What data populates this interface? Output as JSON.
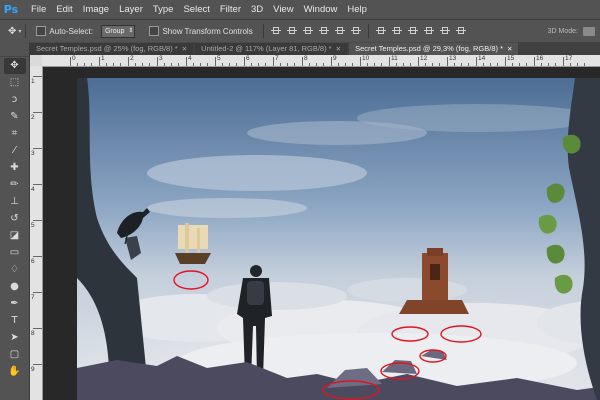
{
  "app": {
    "logo": "Ps"
  },
  "menu": [
    "File",
    "Edit",
    "Image",
    "Layer",
    "Type",
    "Select",
    "Filter",
    "3D",
    "View",
    "Window",
    "Help"
  ],
  "options": {
    "auto_select_label": "Auto-Select:",
    "auto_select_value": "Group",
    "transform_label": "Show Transform Controls",
    "mode_3d_label": "3D Mode:"
  },
  "document_tabs": [
    {
      "label": "Secret Temples.psd @ 25% (fog, RGB/8) *",
      "active": false
    },
    {
      "label": "Untitled-2 @ 117% (Layer 81, RGB/8) *",
      "active": false
    },
    {
      "label": "Secret Temples.psd @ 29,3% (fog, RGB/8) *",
      "active": true
    }
  ],
  "ruler": {
    "h_numbers": [
      "0",
      "1",
      "2",
      "3",
      "4",
      "5",
      "6",
      "7",
      "8",
      "9",
      "10",
      "11",
      "12",
      "13",
      "14",
      "15",
      "16",
      "17"
    ],
    "v_numbers": [
      "1",
      "2",
      "3",
      "4",
      "5",
      "6",
      "7",
      "8",
      "9"
    ]
  },
  "tools": [
    {
      "icon": "move-tool-icon",
      "glyph": "✥"
    },
    {
      "icon": "marquee-tool-icon",
      "glyph": "⬚"
    },
    {
      "icon": "lasso-tool-icon",
      "glyph": "ↄ"
    },
    {
      "icon": "quick-select-tool-icon",
      "glyph": "✎"
    },
    {
      "icon": "crop-tool-icon",
      "glyph": "⌗"
    },
    {
      "icon": "eyedropper-tool-icon",
      "glyph": "⁄"
    },
    {
      "icon": "healing-brush-tool-icon",
      "glyph": "✚"
    },
    {
      "icon": "brush-tool-icon",
      "glyph": "✏"
    },
    {
      "icon": "clone-stamp-tool-icon",
      "glyph": "⊥"
    },
    {
      "icon": "history-brush-tool-icon",
      "glyph": "↺"
    },
    {
      "icon": "eraser-tool-icon",
      "glyph": "◪"
    },
    {
      "icon": "gradient-tool-icon",
      "glyph": "▭"
    },
    {
      "icon": "blur-tool-icon",
      "glyph": "♢"
    },
    {
      "icon": "dodge-tool-icon",
      "glyph": "●"
    },
    {
      "icon": "pen-tool-icon",
      "glyph": "✒"
    },
    {
      "icon": "type-tool-icon",
      "glyph": "T"
    },
    {
      "icon": "path-select-tool-icon",
      "glyph": "➤"
    },
    {
      "icon": "shape-tool-icon",
      "glyph": "▢"
    },
    {
      "icon": "hand-tool-icon",
      "glyph": "✋"
    }
  ],
  "colors": {
    "panel": "#535353",
    "canvas_bg": "#282828",
    "annotation": "#e0141e",
    "sky_top": "#4f6f96",
    "sky_mid": "#93abc6",
    "clouds": "#dfe3ea"
  }
}
